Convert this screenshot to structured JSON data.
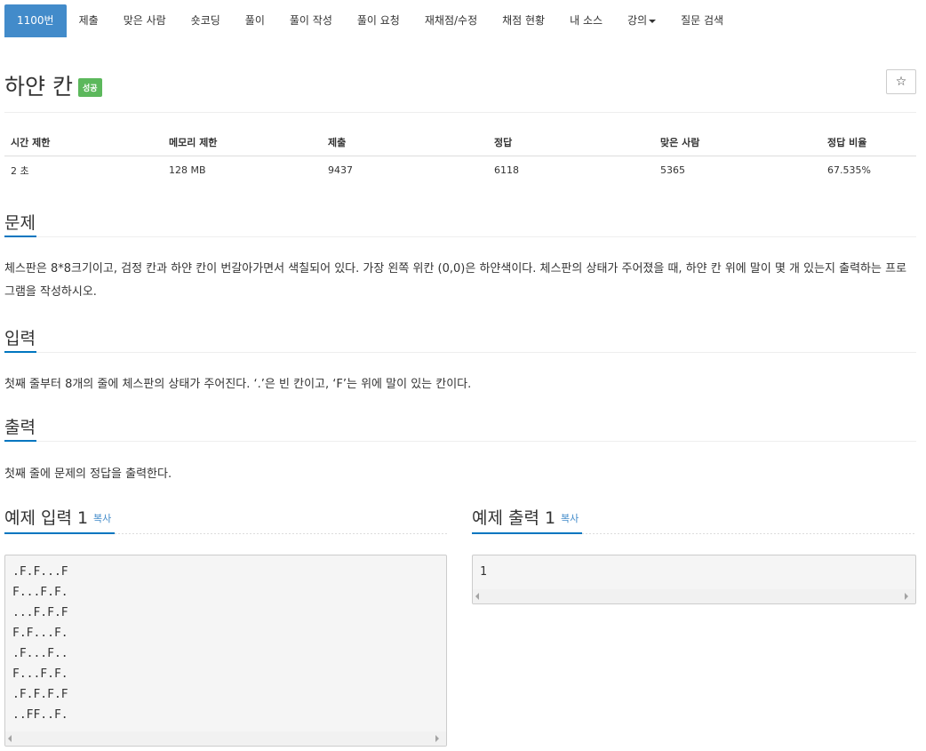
{
  "tabs": [
    {
      "label": "1100번",
      "active": true
    },
    {
      "label": "제출"
    },
    {
      "label": "맞은 사람"
    },
    {
      "label": "숏코딩"
    },
    {
      "label": "풀이"
    },
    {
      "label": "풀이 작성"
    },
    {
      "label": "풀이 요청"
    },
    {
      "label": "재채점/수정"
    },
    {
      "label": "채점 현황"
    },
    {
      "label": "내 소스"
    },
    {
      "label": "강의",
      "dropdown": true
    },
    {
      "label": "질문 검색"
    }
  ],
  "problem": {
    "title": "하얀 칸",
    "status_badge": "성공",
    "star_icon": "☆"
  },
  "info_table": {
    "headers": [
      "시간 제한",
      "메모리 제한",
      "제출",
      "정답",
      "맞은 사람",
      "정답 비율"
    ],
    "values": [
      "2 초",
      "128 MB",
      "9437",
      "6118",
      "5365",
      "67.535%"
    ]
  },
  "sections": {
    "problem": {
      "heading": "문제",
      "text": "체스판은 8*8크기이고, 검정 칸과 하얀 칸이 번갈아가면서 색칠되어 있다. 가장 왼쪽 위칸 (0,0)은 하얀색이다. 체스판의 상태가 주어졌을 때, 하얀 칸 위에 말이 몇 개 있는지 출력하는 프로그램을 작성하시오."
    },
    "input": {
      "heading": "입력",
      "text": "첫째 줄부터 8개의 줄에 체스판의 상태가 주어진다. ‘.’은 빈 칸이고, ‘F’는 위에 말이 있는 칸이다."
    },
    "output": {
      "heading": "출력",
      "text": "첫째 줄에 문제의 정답을 출력한다."
    }
  },
  "samples": {
    "input": {
      "heading": "예제 입력 1",
      "copy_label": "복사",
      "lines": [
        ".F.F...F",
        "F...F.F.",
        "...F.F.F",
        "F.F...F.",
        ".F...F..",
        "F...F.F.",
        ".F.F.F.F",
        "..FF..F."
      ]
    },
    "output": {
      "heading": "예제 출력 1",
      "copy_label": "복사",
      "lines": [
        "1"
      ]
    }
  },
  "colors": {
    "accent": "#428bca",
    "success": "#5cb85c",
    "section_underline": "#0076c0"
  }
}
